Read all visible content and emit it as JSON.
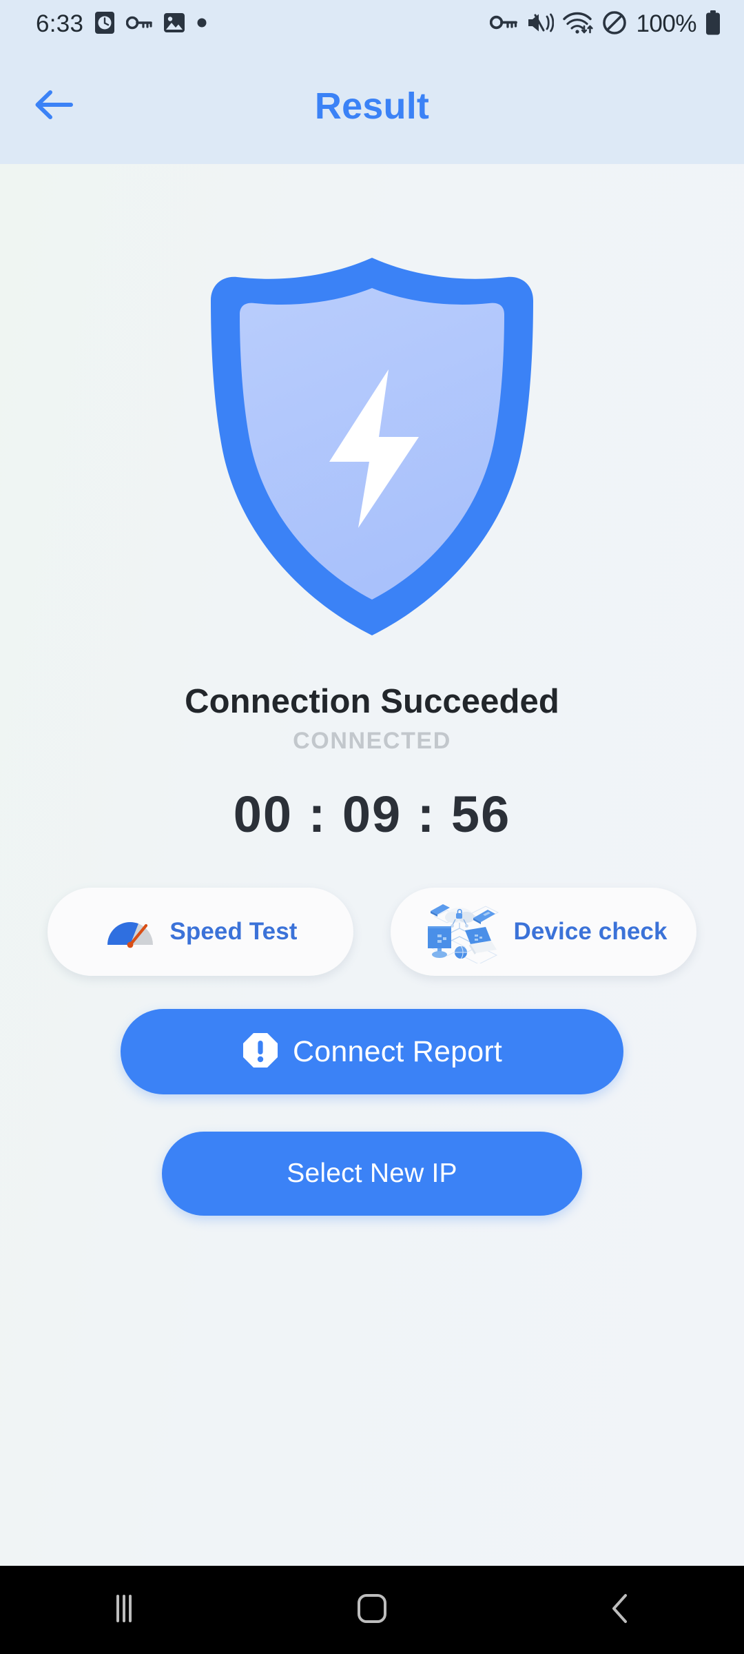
{
  "status_bar": {
    "clock": "6:33",
    "battery_percent": "100%",
    "left_icons": [
      "alarm-clock-icon",
      "vpn-key-icon",
      "photo-icon",
      "dot-indicator-icon"
    ],
    "right_icons": [
      "vpn-key-icon",
      "sound-mute-vibrate-icon",
      "wifi-data-icon",
      "do-not-disturb-icon",
      "battery-icon"
    ],
    "background_color": "#dde9f6",
    "foreground_color": "#2a3440"
  },
  "header": {
    "title": "Result",
    "back_icon": "arrow-left-icon",
    "title_color": "#3b82f6",
    "background_color": "#dde9f6"
  },
  "hero": {
    "icon": "shield-bolt-icon",
    "shield_outline_color": "#3b82f6",
    "shield_fill_color": "#aec5fb",
    "bolt_color": "#ffffff"
  },
  "status": {
    "title": "Connection Succeeded",
    "subtitle": "CONNECTED",
    "title_color": "#22262b",
    "subtitle_color": "#c2c7cc"
  },
  "timer": {
    "hours": "00",
    "separator_1": ":",
    "minutes": "09",
    "separator_2": ":",
    "seconds": "56",
    "display": "00 : 09 : 56",
    "color": "#2b3038"
  },
  "actions": {
    "speed_test": {
      "label": "Speed Test",
      "icon": "speedometer-icon",
      "text_color": "#3b72d8",
      "background_color": "#fbfbfc"
    },
    "device_check": {
      "label": "Device check",
      "icon": "devices-network-icon",
      "text_color": "#3b72d8",
      "background_color": "#fbfbfc"
    },
    "connect_report": {
      "label": "Connect Report",
      "icon": "alert-octagon-icon",
      "text_color": "#ffffff",
      "background_color": "#3b82f6"
    },
    "select_new_ip": {
      "label": "Select New IP",
      "text_color": "#ffffff",
      "background_color": "#3b82f6"
    }
  },
  "nav_bar": {
    "recents_icon": "recents-icon",
    "home_icon": "home-icon",
    "back_icon": "back-chevron-icon",
    "background_color": "#000000",
    "icon_color": "#bdbdbd"
  }
}
